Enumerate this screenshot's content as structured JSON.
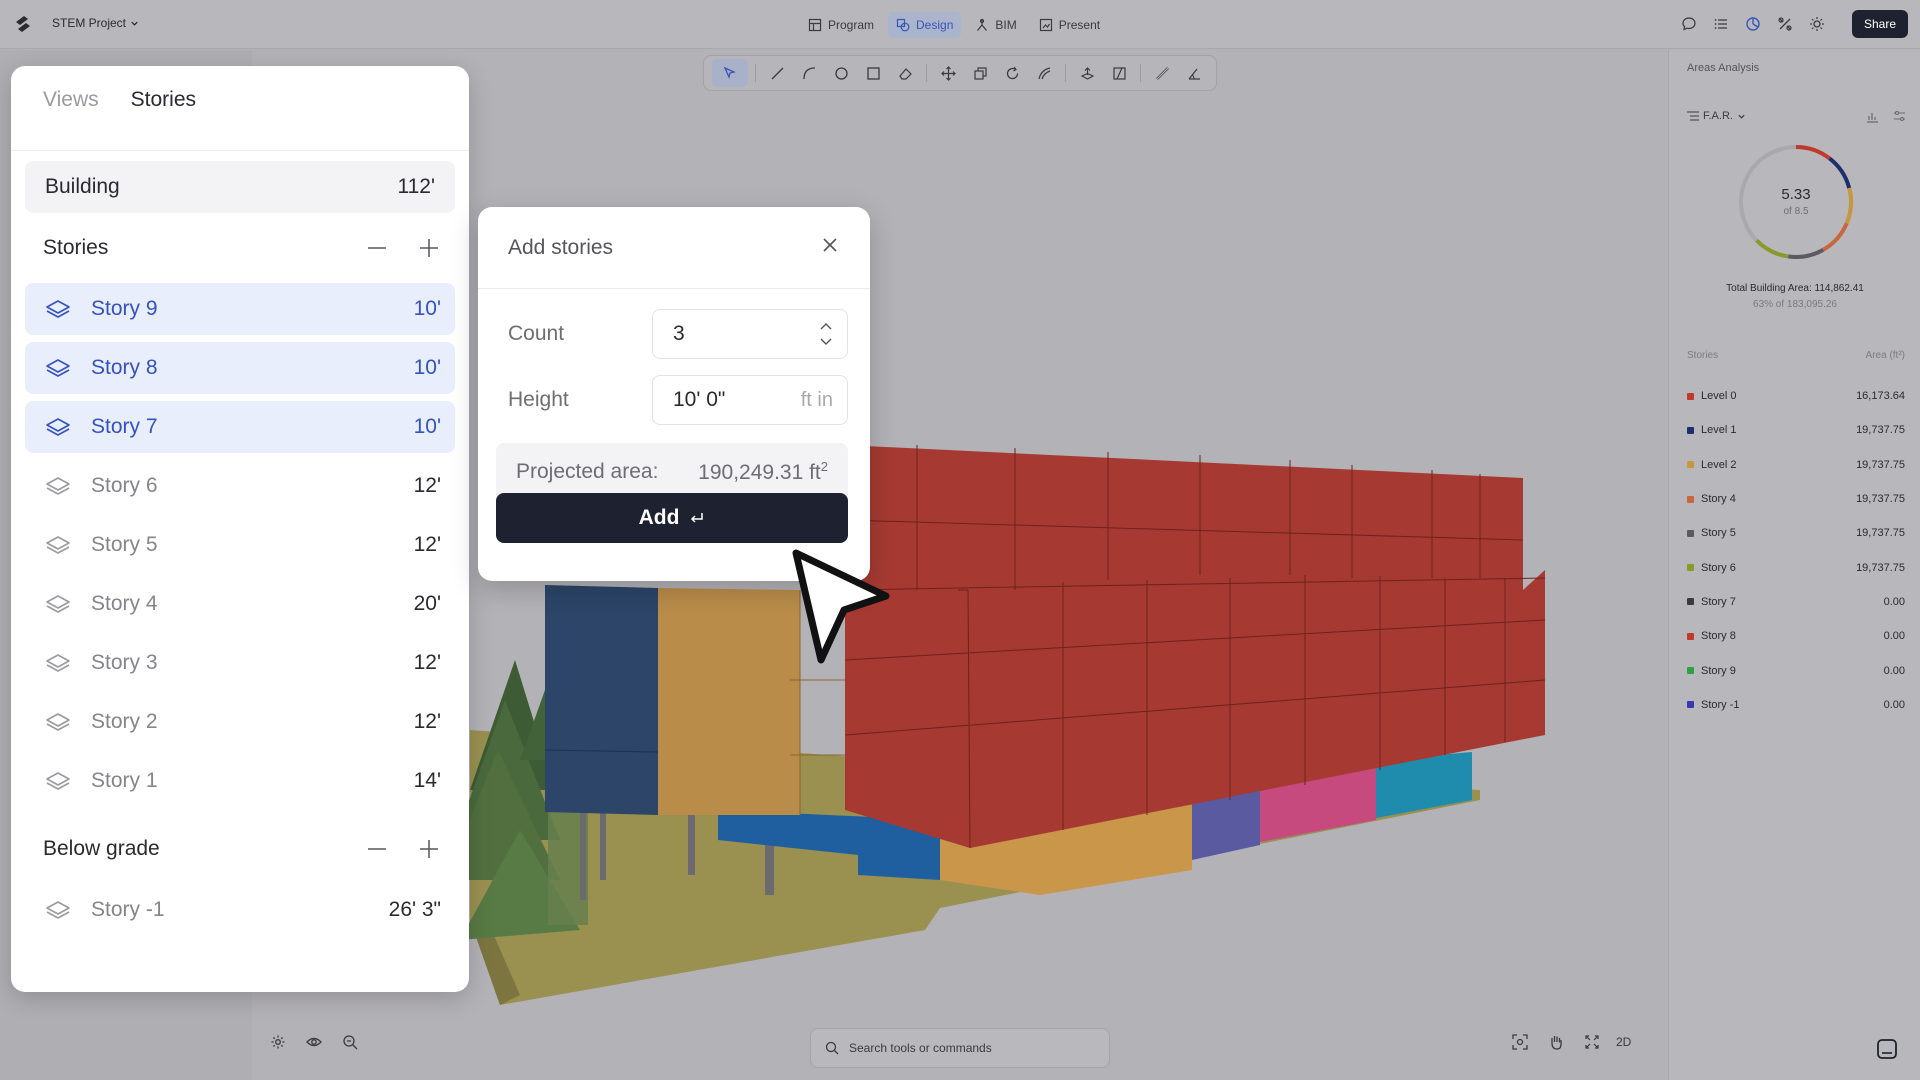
{
  "app": {
    "project_name": "STEM Project",
    "mode_tabs": [
      {
        "label": "Program",
        "icon": "grid-icon"
      },
      {
        "label": "Design",
        "icon": "design-icon"
      },
      {
        "label": "BIM",
        "icon": "bim-icon"
      },
      {
        "label": "Present",
        "icon": "present-icon"
      }
    ],
    "active_mode": "Design",
    "share_label": "Share",
    "accent_color": "#3552c0"
  },
  "stories_panel": {
    "tabs": [
      "Views",
      "Stories"
    ],
    "active_tab": "Stories",
    "building": {
      "label": "Building",
      "height": "112'"
    },
    "stories_section": "Stories",
    "stories": [
      {
        "name": "Story 9",
        "height": "10'",
        "selected": true
      },
      {
        "name": "Story 8",
        "height": "10'",
        "selected": true
      },
      {
        "name": "Story 7",
        "height": "10'",
        "selected": true
      },
      {
        "name": "Story 6",
        "height": "12'",
        "selected": false
      },
      {
        "name": "Story 5",
        "height": "12'",
        "selected": false
      },
      {
        "name": "Story 4",
        "height": "20'",
        "selected": false
      },
      {
        "name": "Story 3",
        "height": "12'",
        "selected": false
      },
      {
        "name": "Story 2",
        "height": "12'",
        "selected": false
      },
      {
        "name": "Story 1",
        "height": "14'",
        "selected": false
      }
    ],
    "below_grade_section": "Below grade",
    "below_grade": [
      {
        "name": "Story -1",
        "height": "26' 3\""
      }
    ]
  },
  "add_stories": {
    "title": "Add stories",
    "count_label": "Count",
    "count_value": "3",
    "height_label": "Height",
    "height_value": "10' 0\"",
    "height_unit": "ft in",
    "projected_label": "Projected area:",
    "projected_value": "190,249.31 ft",
    "projected_exp": "2",
    "add_label": "Add"
  },
  "areas": {
    "title": "Areas Analysis",
    "metric": "F.A.R.",
    "value": "5.33",
    "of": "of 8.5",
    "far_fraction": 0.627,
    "total_label": "Total Building Area: 114,862.41",
    "total_sub": "63% of 183,095.26",
    "list_head_left": "Stories",
    "list_head_right": "Area (ft²)",
    "items": [
      {
        "name": "Level 0",
        "area": "16,173.64",
        "color": "#c0392b"
      },
      {
        "name": "Level 1",
        "area": "19,737.75",
        "color": "#1f2f6e"
      },
      {
        "name": "Level 2",
        "area": "19,737.75",
        "color": "#c8963c"
      },
      {
        "name": "Story 4",
        "area": "19,737.75",
        "color": "#c8663c"
      },
      {
        "name": "Story 5",
        "area": "19,737.75",
        "color": "#5a5a60"
      },
      {
        "name": "Story 6",
        "area": "19,737.75",
        "color": "#8a9a2a"
      },
      {
        "name": "Story 7",
        "area": "0.00",
        "color": "#3a3a40"
      },
      {
        "name": "Story 8",
        "area": "0.00",
        "color": "#c0392b"
      },
      {
        "name": "Story 9",
        "area": "0.00",
        "color": "#2ea043"
      },
      {
        "name": "Story -1",
        "area": "0.00",
        "color": "#3a38b0"
      }
    ]
  },
  "bottom": {
    "search_placeholder": "Search tools or commands",
    "view_2d": "2D"
  }
}
